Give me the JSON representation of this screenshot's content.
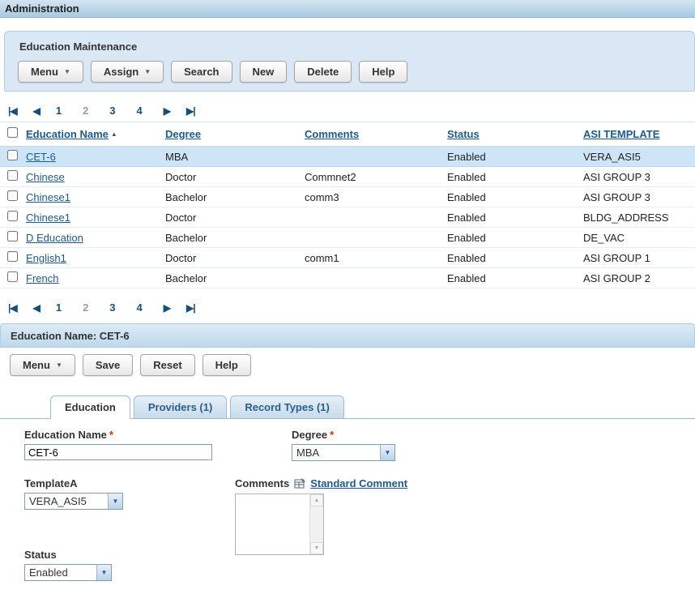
{
  "page": {
    "title": "Administration"
  },
  "colors": {
    "link": "#1a5a96",
    "selected_row": "#cde5f7",
    "panel_bg": "#d9e8f4",
    "panel_border": "#b5cfe2"
  },
  "icons": {
    "dropdown": "▼",
    "sort_asc": "▲",
    "first": "|◀",
    "prev": "◀",
    "next": "▶",
    "last": "▶|",
    "scroll_up": "▲",
    "scroll_down": "▼"
  },
  "panel1": {
    "title": "Education Maintenance",
    "buttons": {
      "menu": "Menu",
      "assign": "Assign",
      "search": "Search",
      "new": "New",
      "delete": "Delete",
      "help": "Help"
    }
  },
  "pager": {
    "pages": [
      "1",
      "2",
      "3",
      "4"
    ],
    "current": "2"
  },
  "table": {
    "headers": {
      "name": "Education Name",
      "degree": "Degree",
      "comments": "Comments",
      "status": "Status",
      "template": "ASI TEMPLATE"
    },
    "rows": [
      {
        "name": "CET-6",
        "degree": "MBA",
        "comments": "",
        "status": "Enabled",
        "template": "VERA_ASI5"
      },
      {
        "name": "Chinese",
        "degree": "Doctor",
        "comments": "Commnet2",
        "status": "Enabled",
        "template": "ASI GROUP 3"
      },
      {
        "name": "Chinese1",
        "degree": "Bachelor",
        "comments": "comm3",
        "status": "Enabled",
        "template": "ASI GROUP 3"
      },
      {
        "name": "Chinese1",
        "degree": "Doctor",
        "comments": "",
        "status": "Enabled",
        "template": "BLDG_ADDRESS"
      },
      {
        "name": "D Education",
        "degree": "Bachelor",
        "comments": "",
        "status": "Enabled",
        "template": "DE_VAC"
      },
      {
        "name": "English1",
        "degree": "Doctor",
        "comments": "comm1",
        "status": "Enabled",
        "template": "ASI GROUP 1"
      },
      {
        "name": "French",
        "degree": "Bachelor",
        "comments": "",
        "status": "Enabled",
        "template": "ASI GROUP 2"
      }
    ]
  },
  "panel2": {
    "title": "Education Name: CET-6",
    "buttons": {
      "menu": "Menu",
      "save": "Save",
      "reset": "Reset",
      "help": "Help"
    }
  },
  "tabs": [
    {
      "label": "Education"
    },
    {
      "label": "Providers (1)"
    },
    {
      "label": "Record Types (1)"
    }
  ],
  "form": {
    "education_name": {
      "label": "Education Name",
      "required": "*",
      "value": "CET-6"
    },
    "degree": {
      "label": "Degree",
      "required": "*",
      "value": "MBA"
    },
    "template": {
      "label": "TemplateA",
      "value": "VERA_ASI5"
    },
    "comments": {
      "label": "Comments",
      "link": "Standard Comment",
      "value": ""
    },
    "status": {
      "label": "Status",
      "value": "Enabled"
    }
  }
}
